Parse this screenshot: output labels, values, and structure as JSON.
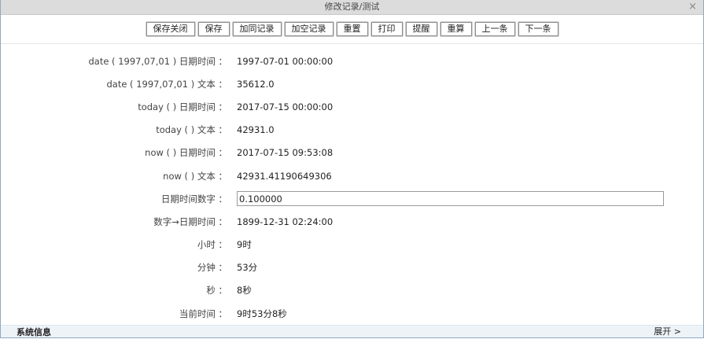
{
  "window": {
    "title": "修改记录/测试",
    "close_glyph": "×"
  },
  "toolbar": {
    "buttons": [
      "保存关闭",
      "保存",
      "加同记录",
      "加空记录",
      "重置",
      "打印",
      "提醒",
      "重算",
      "上一条",
      "下一条"
    ]
  },
  "fields": [
    {
      "label": "date ( 1997,07,01 ) 日期时间 ：",
      "value": "1997-07-01 00:00:00"
    },
    {
      "label": "date ( 1997,07,01 ) 文本 ：",
      "value": "35612.0"
    },
    {
      "label": "today (   ) 日期时间 ：",
      "value": "2017-07-15 00:00:00"
    },
    {
      "label": "today (   ) 文本 ：",
      "value": "42931.0"
    },
    {
      "label": "now (   ) 日期时间 ：",
      "value": "2017-07-15 09:53:08"
    },
    {
      "label": "now (   ) 文本 ：",
      "value": "42931.41190649306"
    },
    {
      "label": "日期时间数字 ：",
      "value": "0.100000"
    },
    {
      "label": "数字→日期时间 ：",
      "value": "1899-12-31 02:24:00"
    },
    {
      "label": "小时 ：",
      "value": "9时"
    },
    {
      "label": "分钟 ：",
      "value": "53分"
    },
    {
      "label": "秒 ：",
      "value": "8秒"
    },
    {
      "label": "当前时间 ：",
      "value": "9时53分8秒"
    }
  ],
  "footer": {
    "title": "系统信息",
    "expand_label": "展开 >"
  }
}
